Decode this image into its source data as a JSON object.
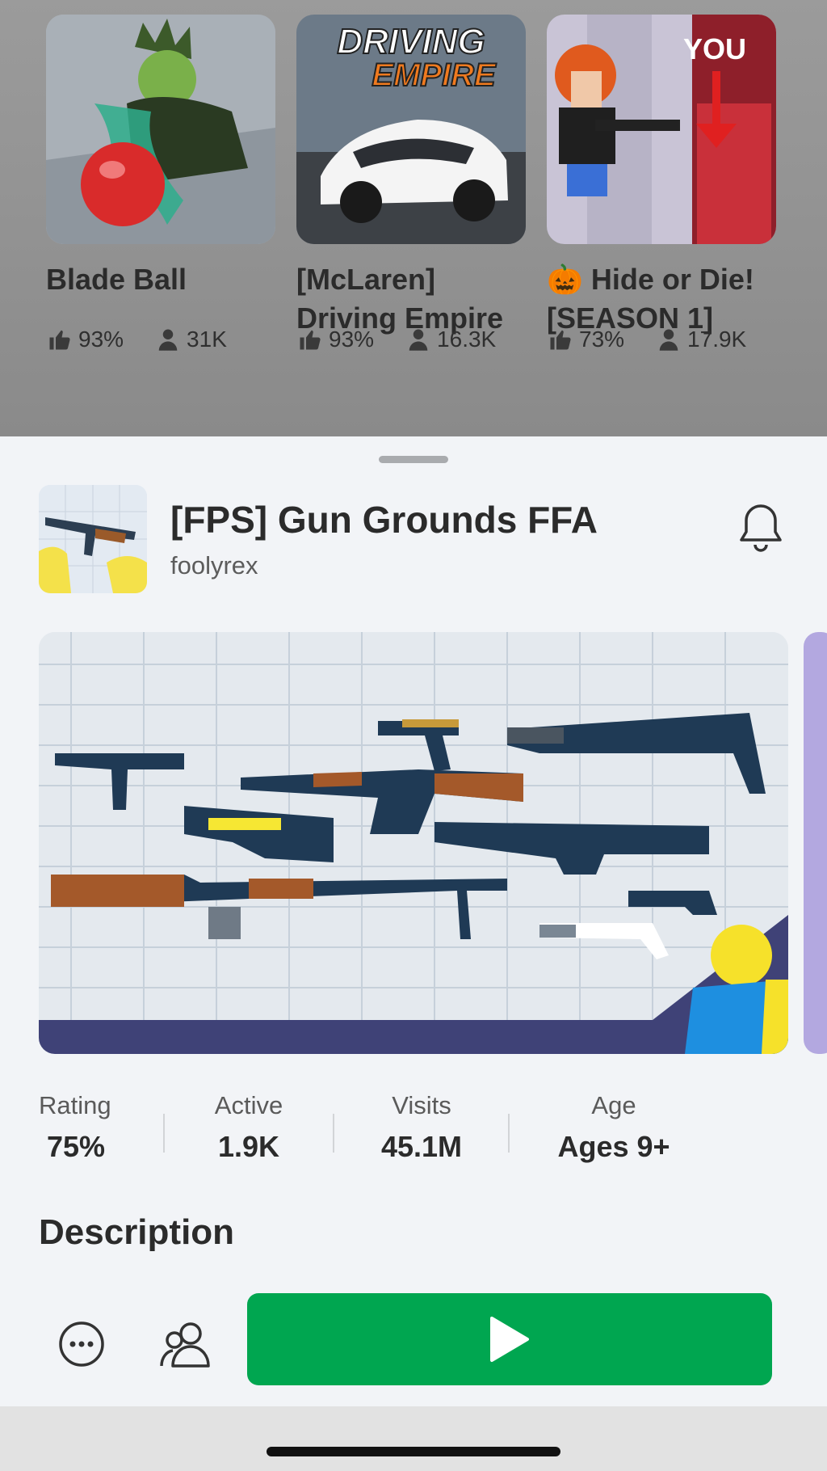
{
  "recommended": [
    {
      "title": "Blade Ball",
      "rating": "93%",
      "players": "31K"
    },
    {
      "title": "[McLaren] Driving Empire",
      "logo_line1": "DRIVING",
      "logo_line2": "EMPIRE",
      "rating": "93%",
      "players": "16.3K"
    },
    {
      "title": "🎃 Hide or Die! [SEASON 1]",
      "thumb_text": "YOU",
      "rating": "73%",
      "players": "17.9K"
    }
  ],
  "game": {
    "title": "[FPS] Gun Grounds FFA",
    "author": "foolyrex"
  },
  "stats": [
    {
      "label": "Rating",
      "value": "75%"
    },
    {
      "label": "Active",
      "value": "1.9K"
    },
    {
      "label": "Visits",
      "value": "45.1M"
    },
    {
      "label": "Age",
      "value": "Ages 9+"
    }
  ],
  "description_heading": "Description",
  "colors": {
    "play": "#00a650",
    "hero_band": "#3f4277",
    "next_card": "#b3a8e0"
  },
  "icons": {
    "more": "more-icon",
    "friends": "friends-icon",
    "play": "play-icon",
    "bell": "bell-icon",
    "thumb": "thumbs-up-icon",
    "player": "player-icon"
  }
}
